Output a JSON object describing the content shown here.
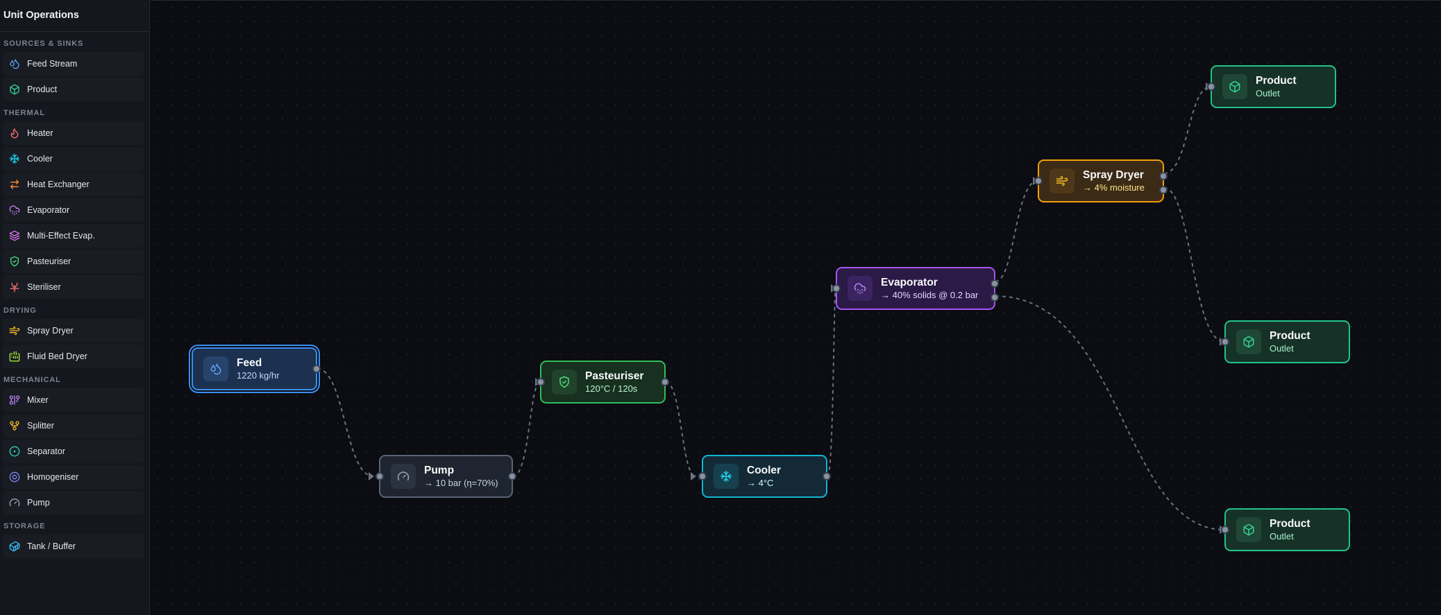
{
  "sidebar": {
    "title": "Unit Operations",
    "sections": [
      {
        "label": "SOURCES & SINKS",
        "items": [
          {
            "label": "Feed Stream",
            "icon": "droplets-icon",
            "color": "#60a5fa"
          },
          {
            "label": "Product",
            "icon": "box-icon",
            "color": "#34d399"
          }
        ]
      },
      {
        "label": "THERMAL",
        "items": [
          {
            "label": "Heater",
            "icon": "flame-icon",
            "color": "#f87171"
          },
          {
            "label": "Cooler",
            "icon": "snowflake-icon",
            "color": "#22d3ee"
          },
          {
            "label": "Heat Exchanger",
            "icon": "arrows-exchange-icon",
            "color": "#fb923c"
          },
          {
            "label": "Evaporator",
            "icon": "cloud-drizzle-icon",
            "color": "#c084fc"
          },
          {
            "label": "Multi-Effect Evap.",
            "icon": "layers-icon",
            "color": "#e879f9"
          },
          {
            "label": "Pasteuriser",
            "icon": "shield-check-icon",
            "color": "#4ade80"
          },
          {
            "label": "Steriliser",
            "icon": "biohazard-icon",
            "color": "#f87171"
          }
        ]
      },
      {
        "label": "DRYING",
        "items": [
          {
            "label": "Spray Dryer",
            "icon": "wind-icon",
            "color": "#fbbf24"
          },
          {
            "label": "Fluid Bed Dryer",
            "icon": "heater-icon",
            "color": "#a3e635"
          }
        ]
      },
      {
        "label": "MECHANICAL",
        "items": [
          {
            "label": "Mixer",
            "icon": "merge-icon",
            "color": "#c084fc"
          },
          {
            "label": "Splitter",
            "icon": "git-fork-icon",
            "color": "#fbbf24"
          },
          {
            "label": "Separator",
            "icon": "circle-dot-icon",
            "color": "#2dd4bf"
          },
          {
            "label": "Homogeniser",
            "icon": "target-icon",
            "color": "#818cf8"
          },
          {
            "label": "Pump",
            "icon": "gauge-icon",
            "color": "#9ca3af"
          }
        ]
      },
      {
        "label": "STORAGE",
        "items": [
          {
            "label": "Tank / Buffer",
            "icon": "container-icon",
            "color": "#38bdf8"
          }
        ]
      }
    ]
  },
  "nodes": [
    {
      "id": "feed",
      "title": "Feed",
      "sub": "1220 kg/hr",
      "icon": "droplets-icon",
      "color": "#60a5fa"
    },
    {
      "id": "pump",
      "title": "Pump",
      "sub": "→ 10 bar (η=70%)",
      "icon": "gauge-icon",
      "color": "#9ca3af"
    },
    {
      "id": "past",
      "title": "Pasteuriser",
      "sub": "120°C / 120s",
      "icon": "shield-check-icon",
      "color": "#4ade80"
    },
    {
      "id": "cool",
      "title": "Cooler",
      "sub": "→ 4°C",
      "icon": "snowflake-icon",
      "color": "#22d3ee"
    },
    {
      "id": "evap",
      "title": "Evaporator",
      "sub": "→ 40% solids @ 0.2 bar",
      "icon": "cloud-drizzle-icon",
      "color": "#c084fc"
    },
    {
      "id": "dry",
      "title": "Spray Dryer",
      "sub": "→ 4% moisture",
      "icon": "wind-icon",
      "color": "#fbbf24"
    },
    {
      "id": "prod1",
      "title": "Product",
      "sub": "Outlet",
      "icon": "box-icon",
      "color": "#34d399"
    },
    {
      "id": "prod2",
      "title": "Product",
      "sub": "Outlet",
      "icon": "box-icon",
      "color": "#34d399"
    },
    {
      "id": "prod3",
      "title": "Product",
      "sub": "Outlet",
      "icon": "box-icon",
      "color": "#34d399"
    }
  ]
}
